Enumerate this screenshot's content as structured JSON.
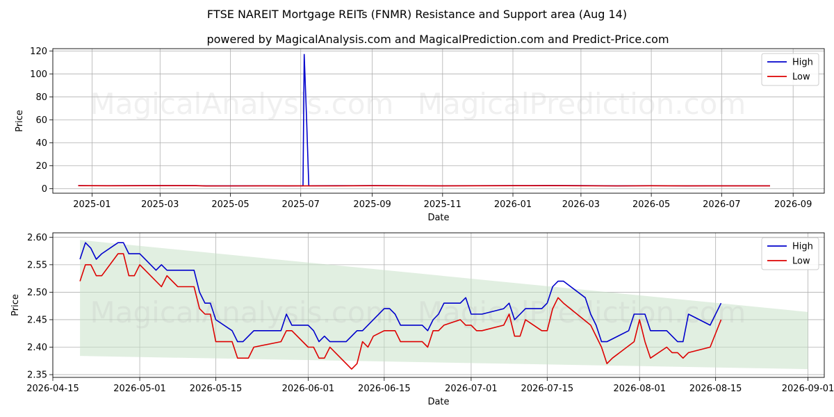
{
  "figure": {
    "title": "FTSE NAREIT Mortgage REITs (FNMR) Resistance and Support area (Aug 14)",
    "subtitle": "powered by MagicalAnalysis.com and MagicalPrediction.com and Predict-Price.com",
    "watermarks": [
      "MagicalAnalysis.com",
      "MagicalPrediction.com"
    ]
  },
  "colors": {
    "high": "#0000cc",
    "low": "#dd0000",
    "band": "#c8e2c8",
    "grid": "#b0b0b0"
  },
  "chart_data": [
    {
      "type": "line",
      "xlabel": "Date",
      "ylabel": "Price",
      "xlim": [
        "2024-11-28",
        "2026-09-28"
      ],
      "ylim": [
        -4,
        122
      ],
      "x_ticks": [
        "2025-01",
        "2025-03",
        "2025-05",
        "2025-07",
        "2025-09",
        "2025-11",
        "2026-01",
        "2026-03",
        "2026-05",
        "2026-07",
        "2026-09"
      ],
      "y_ticks": [
        0,
        20,
        40,
        60,
        80,
        100,
        120
      ],
      "grid": true,
      "legend": "top-right",
      "series": [
        {
          "name": "High",
          "color": "#0000cc",
          "points": [
            [
              "2024-12-20",
              2.6
            ],
            [
              "2025-01-15",
              2.55
            ],
            [
              "2025-02-15",
              2.62
            ],
            [
              "2025-03-15",
              2.65
            ],
            [
              "2025-04-01",
              2.62
            ],
            [
              "2025-04-10",
              2.4
            ],
            [
              "2025-05-01",
              2.42
            ],
            [
              "2025-06-01",
              2.5
            ],
            [
              "2025-06-20",
              2.45
            ],
            [
              "2025-07-03",
              2.5
            ],
            [
              "2025-07-04",
              117
            ],
            [
              "2025-07-06",
              63
            ],
            [
              "2025-07-08",
              2.5
            ],
            [
              "2025-08-01",
              2.55
            ],
            [
              "2025-09-01",
              2.62
            ],
            [
              "2025-10-01",
              2.55
            ],
            [
              "2025-11-01",
              2.5
            ],
            [
              "2025-12-01",
              2.55
            ],
            [
              "2026-01-01",
              2.6
            ],
            [
              "2026-02-01",
              2.7
            ],
            [
              "2026-03-01",
              2.6
            ],
            [
              "2026-04-01",
              2.45
            ],
            [
              "2026-05-01",
              2.57
            ],
            [
              "2026-06-01",
              2.44
            ],
            [
              "2026-07-01",
              2.46
            ],
            [
              "2026-08-12",
              2.48
            ]
          ]
        },
        {
          "name": "Low",
          "color": "#dd0000",
          "points": [
            [
              "2024-12-20",
              2.52
            ],
            [
              "2025-01-15",
              2.48
            ],
            [
              "2025-02-15",
              2.55
            ],
            [
              "2025-03-15",
              2.6
            ],
            [
              "2025-04-01",
              2.55
            ],
            [
              "2025-04-10",
              2.3
            ],
            [
              "2025-05-01",
              2.35
            ],
            [
              "2025-06-01",
              2.42
            ],
            [
              "2025-07-03",
              2.4
            ],
            [
              "2025-07-08",
              2.42
            ],
            [
              "2025-08-01",
              2.45
            ],
            [
              "2025-09-01",
              2.55
            ],
            [
              "2025-10-01",
              2.48
            ],
            [
              "2025-11-01",
              2.44
            ],
            [
              "2025-12-01",
              2.5
            ],
            [
              "2026-01-01",
              2.52
            ],
            [
              "2026-02-01",
              2.6
            ],
            [
              "2026-03-01",
              2.5
            ],
            [
              "2026-04-01",
              2.38
            ],
            [
              "2026-05-01",
              2.5
            ],
            [
              "2026-06-01",
              2.4
            ],
            [
              "2026-07-01",
              2.44
            ],
            [
              "2026-08-12",
              2.45
            ]
          ]
        }
      ]
    },
    {
      "type": "line",
      "xlabel": "Date",
      "ylabel": "Price",
      "xlim": [
        "2026-04-15",
        "2026-09-04"
      ],
      "ylim": [
        2.345,
        2.608
      ],
      "x_ticks": [
        "2026-04-15",
        "2026-05-01",
        "2026-05-15",
        "2026-06-01",
        "2026-06-15",
        "2026-07-01",
        "2026-07-15",
        "2026-08-01",
        "2026-08-15",
        "2026-09-01"
      ],
      "y_ticks": [
        2.35,
        2.4,
        2.45,
        2.5,
        2.55,
        2.6
      ],
      "grid": true,
      "legend": "top-right",
      "support_resistance_band": {
        "x": [
          "2026-04-20",
          "2026-09-01"
        ],
        "upper": [
          2.595,
          2.464
        ],
        "lower": [
          2.384,
          2.36
        ]
      },
      "series": [
        {
          "name": "High",
          "color": "#0000cc",
          "points": [
            [
              "2026-04-20",
              2.56
            ],
            [
              "2026-04-21",
              2.59
            ],
            [
              "2026-04-22",
              2.58
            ],
            [
              "2026-04-23",
              2.56
            ],
            [
              "2026-04-24",
              2.57
            ],
            [
              "2026-04-27",
              2.59
            ],
            [
              "2026-04-28",
              2.59
            ],
            [
              "2026-04-29",
              2.57
            ],
            [
              "2026-05-01",
              2.57
            ],
            [
              "2026-05-04",
              2.54
            ],
            [
              "2026-05-05",
              2.55
            ],
            [
              "2026-05-06",
              2.54
            ],
            [
              "2026-05-11",
              2.54
            ],
            [
              "2026-05-12",
              2.5
            ],
            [
              "2026-05-13",
              2.48
            ],
            [
              "2026-05-14",
              2.48
            ],
            [
              "2026-05-15",
              2.45
            ],
            [
              "2026-05-18",
              2.43
            ],
            [
              "2026-05-19",
              2.41
            ],
            [
              "2026-05-20",
              2.41
            ],
            [
              "2026-05-22",
              2.43
            ],
            [
              "2026-05-27",
              2.43
            ],
            [
              "2026-05-28",
              2.46
            ],
            [
              "2026-05-29",
              2.44
            ],
            [
              "2026-06-01",
              2.44
            ],
            [
              "2026-06-02",
              2.43
            ],
            [
              "2026-06-03",
              2.41
            ],
            [
              "2026-06-04",
              2.42
            ],
            [
              "2026-06-05",
              2.41
            ],
            [
              "2026-06-08",
              2.41
            ],
            [
              "2026-06-10",
              2.43
            ],
            [
              "2026-06-11",
              2.43
            ],
            [
              "2026-06-15",
              2.47
            ],
            [
              "2026-06-16",
              2.47
            ],
            [
              "2026-06-17",
              2.46
            ],
            [
              "2026-06-18",
              2.44
            ],
            [
              "2026-06-22",
              2.44
            ],
            [
              "2026-06-23",
              2.43
            ],
            [
              "2026-06-24",
              2.45
            ],
            [
              "2026-06-25",
              2.46
            ],
            [
              "2026-06-26",
              2.48
            ],
            [
              "2026-06-29",
              2.48
            ],
            [
              "2026-06-30",
              2.49
            ],
            [
              "2026-07-01",
              2.46
            ],
            [
              "2026-07-03",
              2.46
            ],
            [
              "2026-07-07",
              2.47
            ],
            [
              "2026-07-08",
              2.48
            ],
            [
              "2026-07-09",
              2.45
            ],
            [
              "2026-07-10",
              2.46
            ],
            [
              "2026-07-11",
              2.47
            ],
            [
              "2026-07-14",
              2.47
            ],
            [
              "2026-07-15",
              2.48
            ],
            [
              "2026-07-16",
              2.51
            ],
            [
              "2026-07-17",
              2.52
            ],
            [
              "2026-07-18",
              2.52
            ],
            [
              "2026-07-22",
              2.49
            ],
            [
              "2026-07-23",
              2.46
            ],
            [
              "2026-07-24",
              2.44
            ],
            [
              "2026-07-25",
              2.41
            ],
            [
              "2026-07-26",
              2.41
            ],
            [
              "2026-07-30",
              2.43
            ],
            [
              "2026-07-31",
              2.46
            ],
            [
              "2026-08-02",
              2.46
            ],
            [
              "2026-08-03",
              2.43
            ],
            [
              "2026-08-06",
              2.43
            ],
            [
              "2026-08-08",
              2.41
            ],
            [
              "2026-08-09",
              2.41
            ],
            [
              "2026-08-10",
              2.46
            ],
            [
              "2026-08-14",
              2.44
            ],
            [
              "2026-08-16",
              2.48
            ]
          ]
        },
        {
          "name": "Low",
          "color": "#dd0000",
          "points": [
            [
              "2026-04-20",
              2.52
            ],
            [
              "2026-04-21",
              2.55
            ],
            [
              "2026-04-22",
              2.55
            ],
            [
              "2026-04-23",
              2.53
            ],
            [
              "2026-04-24",
              2.53
            ],
            [
              "2026-04-27",
              2.57
            ],
            [
              "2026-04-28",
              2.57
            ],
            [
              "2026-04-29",
              2.53
            ],
            [
              "2026-04-30",
              2.53
            ],
            [
              "2026-05-01",
              2.55
            ],
            [
              "2026-05-05",
              2.51
            ],
            [
              "2026-05-06",
              2.53
            ],
            [
              "2026-05-08",
              2.51
            ],
            [
              "2026-05-11",
              2.51
            ],
            [
              "2026-05-12",
              2.47
            ],
            [
              "2026-05-13",
              2.46
            ],
            [
              "2026-05-14",
              2.46
            ],
            [
              "2026-05-15",
              2.41
            ],
            [
              "2026-05-18",
              2.41
            ],
            [
              "2026-05-19",
              2.38
            ],
            [
              "2026-05-21",
              2.38
            ],
            [
              "2026-05-22",
              2.4
            ],
            [
              "2026-05-27",
              2.41
            ],
            [
              "2026-05-28",
              2.43
            ],
            [
              "2026-05-29",
              2.43
            ],
            [
              "2026-06-01",
              2.4
            ],
            [
              "2026-06-02",
              2.4
            ],
            [
              "2026-06-03",
              2.38
            ],
            [
              "2026-06-04",
              2.38
            ],
            [
              "2026-06-05",
              2.4
            ],
            [
              "2026-06-09",
              2.36
            ],
            [
              "2026-06-10",
              2.37
            ],
            [
              "2026-06-11",
              2.41
            ],
            [
              "2026-06-12",
              2.4
            ],
            [
              "2026-06-13",
              2.42
            ],
            [
              "2026-06-15",
              2.43
            ],
            [
              "2026-06-17",
              2.43
            ],
            [
              "2026-06-18",
              2.41
            ],
            [
              "2026-06-22",
              2.41
            ],
            [
              "2026-06-23",
              2.4
            ],
            [
              "2026-06-24",
              2.43
            ],
            [
              "2026-06-25",
              2.43
            ],
            [
              "2026-06-26",
              2.44
            ],
            [
              "2026-06-29",
              2.45
            ],
            [
              "2026-06-30",
              2.44
            ],
            [
              "2026-07-01",
              2.44
            ],
            [
              "2026-07-02",
              2.43
            ],
            [
              "2026-07-03",
              2.43
            ],
            [
              "2026-07-07",
              2.44
            ],
            [
              "2026-07-08",
              2.46
            ],
            [
              "2026-07-09",
              2.42
            ],
            [
              "2026-07-10",
              2.42
            ],
            [
              "2026-07-11",
              2.45
            ],
            [
              "2026-07-14",
              2.43
            ],
            [
              "2026-07-15",
              2.43
            ],
            [
              "2026-07-16",
              2.47
            ],
            [
              "2026-07-17",
              2.49
            ],
            [
              "2026-07-18",
              2.48
            ],
            [
              "2026-07-23",
              2.44
            ],
            [
              "2026-07-25",
              2.4
            ],
            [
              "2026-07-26",
              2.37
            ],
            [
              "2026-07-27",
              2.38
            ],
            [
              "2026-07-31",
              2.41
            ],
            [
              "2026-08-01",
              2.45
            ],
            [
              "2026-08-02",
              2.41
            ],
            [
              "2026-08-03",
              2.38
            ],
            [
              "2026-08-06",
              2.4
            ],
            [
              "2026-08-07",
              2.39
            ],
            [
              "2026-08-08",
              2.39
            ],
            [
              "2026-08-09",
              2.38
            ],
            [
              "2026-08-10",
              2.39
            ],
            [
              "2026-08-14",
              2.4
            ],
            [
              "2026-08-16",
              2.45
            ]
          ]
        }
      ]
    }
  ]
}
